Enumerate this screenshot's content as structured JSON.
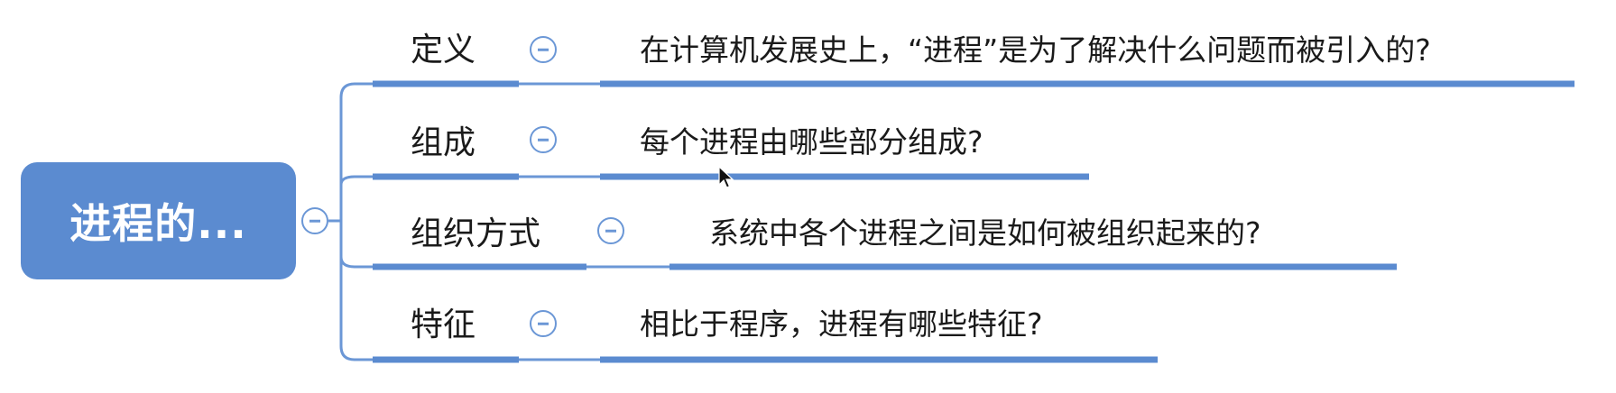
{
  "root": {
    "label": "进程的..."
  },
  "branches": [
    {
      "label": "定义",
      "text": "在计算机发展史上，“进程”是为了解决什么问题而被引入的?"
    },
    {
      "label": "组成",
      "text": "每个进程由哪些部分组成?"
    },
    {
      "label": "组织方式",
      "text": "系统中各个进程之间是如何被组织起来的?"
    },
    {
      "label": "特征",
      "text": "相比于程序，进程有哪些特征?"
    }
  ],
  "colors": {
    "accent": "#5b8bd0",
    "line": "#6b97d6"
  },
  "icons": {
    "collapse": "minus-circle-icon",
    "cursor": "mouse-pointer-icon"
  }
}
